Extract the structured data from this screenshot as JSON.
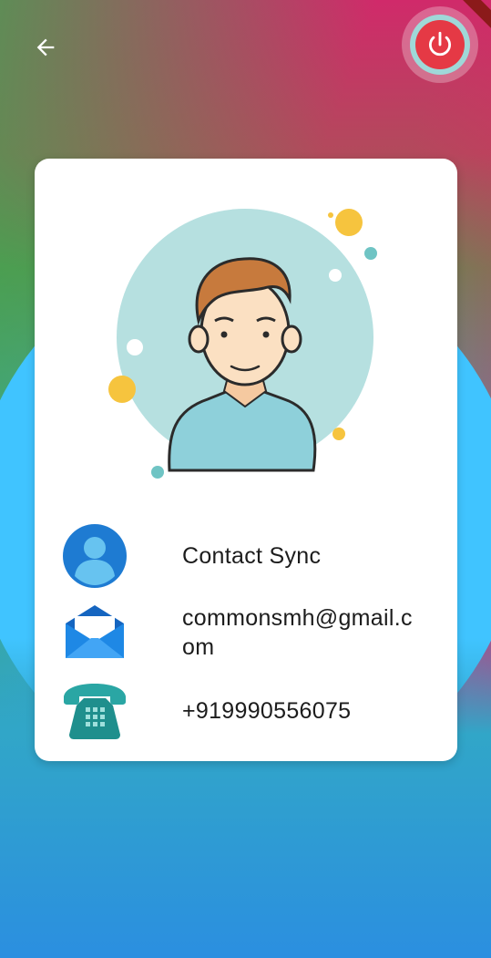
{
  "header": {
    "back_icon": "arrow-left-icon",
    "power_icon": "power-icon"
  },
  "profile": {
    "avatar_illustration": "user-avatar-illustration",
    "name": "Contact Sync",
    "email": "commonsmh@gmail.com",
    "phone": "+919990556075"
  },
  "icons": {
    "name": "person-circle-icon",
    "email": "mail-envelope-icon",
    "phone": "telephone-icon"
  },
  "colors": {
    "accent_power": "#e53945",
    "card_bg": "#ffffff",
    "circle_bg": "#40c4ff"
  }
}
